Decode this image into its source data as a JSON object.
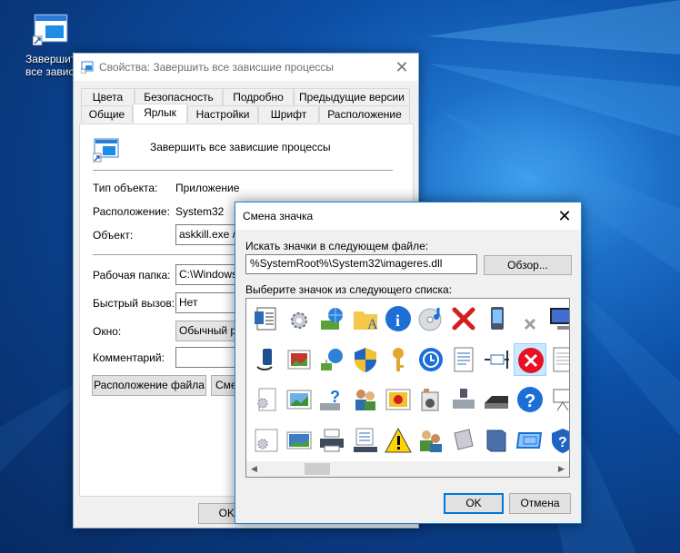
{
  "desktop": {
    "shortcut_label_line1": "Завершить",
    "shortcut_label_line2": "все завис"
  },
  "properties_window": {
    "title": "Свойства: Завершить все зависшие процессы",
    "tabs_row1": [
      "Цвета",
      "Безопасность",
      "Подробно",
      "Предыдущие версии"
    ],
    "tabs_row2": [
      "Общие",
      "Ярлык",
      "Настройки",
      "Шрифт",
      "Расположение"
    ],
    "active_tab": "Ярлык",
    "shortcut_name": "Завершить все зависшие процессы",
    "type_label": "Тип объекта:",
    "type_value": "Приложение",
    "location_label": "Расположение:",
    "location_value": "System32",
    "target_label": "Объект:",
    "target_value": "askkill.exe /F",
    "start_in_label": "Рабочая папка:",
    "start_in_value": "C:\\Windows\\",
    "hotkey_label": "Быстрый вызов:",
    "hotkey_value": "Нет",
    "run_label": "Окно:",
    "run_value": "Обычный ра",
    "comment_label": "Комментарий:",
    "comment_value": "",
    "open_location_button": "Расположение файла",
    "change_icon_button": "Смен",
    "ok_button": "OK"
  },
  "change_icon_dialog": {
    "title": "Смена значка",
    "file_label": "Искать значки в следующем файле:",
    "file_value": "%SystemRoot%\\System32\\imageres.dll",
    "browse_button": "Обзор...",
    "list_label": "Выберите значок из следующего списка:",
    "ok_button": "OK",
    "cancel_button": "Отмена",
    "icons": [
      [
        "document-list-icon",
        "settings-gear-icon",
        "network-computer-icon",
        "font-folder-icon",
        "info-icon",
        "cd-audio-icon",
        "red-x-icon",
        "pda-device-icon",
        "small-gray-x-icon",
        "monitor-icon"
      ],
      [
        "mobile-device-icon",
        "picture-tile-icon",
        "network-share-icon",
        "uac-shield-icon",
        "key-icon",
        "sync-clock-icon",
        "document-lines-icon",
        "resize-cursor-icon",
        "error-circle-icon",
        "blank-page-icon"
      ],
      [
        "gear-document-icon",
        "picture-frame-icon",
        "help-drive-icon",
        "users-group-icon",
        "red-flower-picture-icon",
        "media-drive-icon",
        "media-card-drive-icon",
        "scanner-icon",
        "help-circle-icon",
        "projector-board-icon"
      ],
      [
        "gear-window-icon",
        "landscape-picture-icon",
        "printer-icon",
        "network-rack-icon",
        "warning-icon",
        "user-accounts-icon",
        "cartridge-icon",
        "blue-book-icon",
        "blue-frame-icon",
        "shield-help-icon"
      ]
    ],
    "selected_icon": "error-circle-icon"
  }
}
